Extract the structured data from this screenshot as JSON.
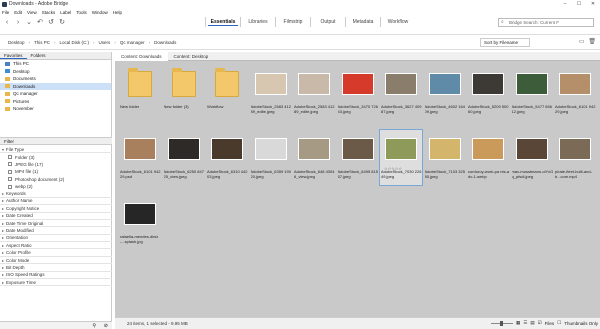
{
  "window": {
    "title": "Downloads - Adobe Bridge"
  },
  "menu": [
    "File",
    "Edit",
    "View",
    "Stacks",
    "Label",
    "Tools",
    "Window",
    "Help"
  ],
  "workspaces": [
    "Essentials",
    "Libraries",
    "Filmstrip",
    "Output",
    "Metadata",
    "Workflow"
  ],
  "search": {
    "placeholder": "Bridge Search: Current F"
  },
  "path": [
    "Desktop",
    "This PC",
    "Local Disk (C:)",
    "Users",
    "Qc manager",
    "Downloads"
  ],
  "sort": {
    "label": "Sort by Filename"
  },
  "leftTabs": [
    "Favorites",
    "Folders"
  ],
  "favorites": [
    "This PC",
    "Desktop",
    "Documents",
    "Downloads",
    "Qc manager",
    "Pictures",
    "November"
  ],
  "filter": {
    "title": "Filter",
    "filetype": "File Type",
    "types": [
      "Folder (3)",
      "JPEG file (17)",
      "MP4 file (1)",
      "Photoshop document (2)",
      "webp (2)"
    ],
    "rows": [
      "Keywords",
      "Author Name",
      "Copyright Notice",
      "Date Created",
      "Date Time Original",
      "Date Modified",
      "Orientation",
      "Aspect Ratio",
      "Color Profile",
      "Color Mode",
      "Bit Depth",
      "ISO Speed Ratings",
      "Exposure Time"
    ]
  },
  "contentTabs": [
    "Content: Downloads",
    "Content: Desktop"
  ],
  "items": [
    {
      "name": "New folder",
      "type": "folder"
    },
    {
      "name": "New folder (3)",
      "type": "folder"
    },
    {
      "name": "Workflow",
      "type": "folder"
    },
    {
      "name": "AdobeStock_2583 41289_edite.jpeg",
      "type": "photo",
      "color": "#d8c7b0"
    },
    {
      "name": "AdobeStock_2583 41289_edite.jpeg",
      "type": "photo",
      "color": "#c8b9a8"
    },
    {
      "name": "AdobeStock_3470 72643.jpeg",
      "type": "photo",
      "color": "#d63a2a"
    },
    {
      "name": "AdobeStock_3627 40987.jpeg",
      "type": "photo",
      "color": "#8a7d6b"
    },
    {
      "name": "AdobeStock_4602 16409.jpeg",
      "type": "photo",
      "color": "#5f8aa8"
    },
    {
      "name": "AdobeStock_5209 50060.jpeg",
      "type": "photo",
      "color": "#3d3a36"
    },
    {
      "name": "AdobeStock_5477 65612.jpeg",
      "type": "photo",
      "color": "#3d5c3a"
    },
    {
      "name": "AdobeStock_6101 94229.jpeg",
      "type": "photo",
      "color": "#b58e6a"
    },
    {
      "name": "AdobeStock_6101 94229.psd",
      "type": "photo",
      "color": "#a8805e"
    },
    {
      "name": "AdobeStock_6250 84725_view.jpeg",
      "type": "photo",
      "color": "#2d2a28"
    },
    {
      "name": "AdobeStock_6310 44203.jpeg",
      "type": "photo",
      "color": "#4a3a2c"
    },
    {
      "name": "AdobeStock_6359 19020.jpeg",
      "type": "photo",
      "color": "#d9d9d9"
    },
    {
      "name": "AdobeStock_648 43046_view.jpeg",
      "type": "photo",
      "color": "#a79a84"
    },
    {
      "name": "AdobeStock_6495 81567.jpeg",
      "type": "photo",
      "color": "#6b5a48"
    },
    {
      "name": "AdobeStock_7030 22649.jpeg",
      "type": "photo",
      "color": "#8e9a5a"
    },
    {
      "name": "AdobeStock_7103 32580.jpeg",
      "type": "photo",
      "color": "#d3b56c"
    },
    {
      "name": "corduroy-work-pa nts-adv-1-webp",
      "type": "photo",
      "color": "#c99a5a"
    },
    {
      "name": "max-musstmann-oiYxGq_pfsdi.jpeg",
      "type": "photo",
      "color": "#5a4636"
    },
    {
      "name": "pirate-fleet-built-and-b...com.mp4",
      "type": "photo",
      "color": "#7a6a56"
    },
    {
      "name": "rafaella-mendes-diniz-...splash.jpg",
      "type": "photo",
      "color": "#262626"
    }
  ],
  "selectedIndex": 17,
  "rating": "☆☆☆☆☆",
  "status": "24 items, 1 selected - 9.95 MB",
  "statusCtrl": {
    "files": "Files",
    "thumbs": "Thumbnails Only"
  },
  "icons": [
    "back-icon",
    "forward-icon",
    "recent-icon",
    "boomerang-icon",
    "rotate-left-icon",
    "rotate-right-icon"
  ]
}
